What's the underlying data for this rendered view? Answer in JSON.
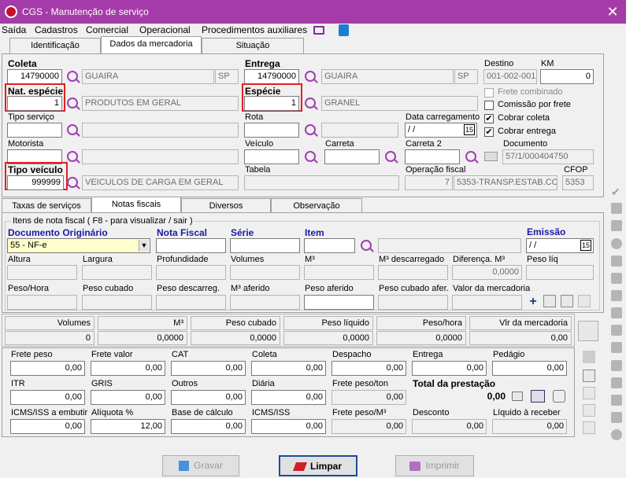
{
  "window": {
    "title": "CGS - Manutenção de serviço",
    "close": "✕"
  },
  "menu": [
    "Saída",
    "Cadastros",
    "Comercial",
    "Operacional",
    "Procedimentos auxiliares"
  ],
  "top_tabs": [
    "Identificação",
    "Dados da mercadoria",
    "Situação"
  ],
  "coleta": {
    "label": "Coleta",
    "cep": "14790000",
    "cidade": "GUAIRA",
    "uf": "SP"
  },
  "entrega": {
    "label": "Entrega",
    "cep": "14790000",
    "cidade": "GUAIRA",
    "uf": "SP"
  },
  "destino": {
    "label": "Destino",
    "value": "001-002-001"
  },
  "km": {
    "label": "KM",
    "value": "0"
  },
  "nat_especie": {
    "label": "Nat. espécie",
    "value": "1",
    "desc": "PRODUTOS EM GERAL"
  },
  "especie": {
    "label": "Espécie",
    "value": "1",
    "desc": "GRANEL"
  },
  "checks": {
    "frete_combinado": "Frete combinado",
    "comissao_frete": "Comissão por frete",
    "cobrar_coleta": "Cobrar coleta",
    "cobrar_entrega": "Cobrar entrega",
    "check_mark": "✔"
  },
  "tipo_servico": {
    "label": "Tipo serviço"
  },
  "rota": {
    "label": "Rota"
  },
  "data_carregamento": {
    "label": "Data carregamento",
    "value": " /  /",
    "cal": "15"
  },
  "motorista": {
    "label": "Motorista"
  },
  "veiculo": {
    "label": "Veículo"
  },
  "carreta": {
    "label": "Carreta"
  },
  "carreta2": {
    "label": "Carreta 2"
  },
  "documento": {
    "label": "Documento",
    "value": "57/1/000404750"
  },
  "tipo_veiculo": {
    "label": "Tipo veículo",
    "value": "999999",
    "desc": "VEICULOS DE CARGA EM GERAL"
  },
  "tabela": {
    "label": "Tabela"
  },
  "operacao_fiscal": {
    "label": "Operação fiscal",
    "code": "7",
    "desc": "5353-TRANSP.ESTAB.CO"
  },
  "cfop": {
    "label": "CFOP",
    "value": "5353"
  },
  "sub_tabs": [
    "Taxas de serviços",
    "Notas fiscais",
    "Diversos",
    "Observação"
  ],
  "itens": {
    "group_label": "Itens de nota fiscal ( F8 - para visualizar / sair )",
    "doc_originario_label": "Documento Originário",
    "doc_originario_value": "55 - NF-e",
    "nota_fiscal_label": "Nota Fiscal",
    "serie_label": "Série",
    "item_label": "Item",
    "emissao_label": "Emissão",
    "emissao_value": " /  /",
    "emissao_cal": "15",
    "row2_labels": [
      "Altura",
      "Largura",
      "Profundidade",
      "Volumes",
      "M³",
      "M³ descarregado",
      "Diferença. M³",
      "Peso líq"
    ],
    "diferenca_value": "0,0000",
    "row3_labels": [
      "Peso/Hora",
      "Peso cubado",
      "Peso descarreg.",
      "M³ aferido",
      "Peso aferido",
      "Peso cubado afer.",
      "Valor da mercadoria"
    ],
    "add_icon": "+"
  },
  "summary": {
    "headers": [
      "Volumes",
      "M³",
      "Peso cubado",
      "Peso líquido",
      "Peso/hora",
      "Vlr da mercadoria"
    ],
    "values": [
      "0",
      "0,0000",
      "0,0000",
      "0,0000",
      "0,0000",
      "0,00"
    ]
  },
  "prestacao": {
    "row1": [
      {
        "label": "Frete peso",
        "value": "0,00"
      },
      {
        "label": "Frete valor",
        "value": "0,00"
      },
      {
        "label": "CAT",
        "value": "0,00"
      },
      {
        "label": "Coleta",
        "value": "0,00"
      },
      {
        "label": "Despacho",
        "value": "0,00"
      },
      {
        "label": "Entrega",
        "value": "0,00"
      },
      {
        "label": "Pedágio",
        "value": "0,00"
      }
    ],
    "row2": [
      {
        "label": "ITR",
        "value": "0,00"
      },
      {
        "label": "GRIS",
        "value": "0,00"
      },
      {
        "label": "Outros",
        "value": "0,00"
      },
      {
        "label": "Diária",
        "value": "0,00"
      },
      {
        "label": "Frete peso/ton",
        "value": "0,00"
      }
    ],
    "total_label": "Total da prestação",
    "total_value": "0,00",
    "row3": [
      {
        "label": "ICMS/ISS a embutir",
        "value": "0,00"
      },
      {
        "label": "Alíquota %",
        "value": "12,00"
      },
      {
        "label": "Base de cálculo",
        "value": "0,00"
      },
      {
        "label": "ICMS/ISS",
        "value": "0,00"
      },
      {
        "label": "Frete peso/M³",
        "value": "0,00"
      },
      {
        "label": "Desconto",
        "value": "0,00"
      },
      {
        "label": "Líquido à receber",
        "value": "0,00"
      }
    ]
  },
  "buttons": {
    "gravar": "Gravar",
    "limpar": "Limpar",
    "imprimir": "Imprimir"
  },
  "colors": {
    "titlebar": "#a53ba8",
    "highlight": "#e0202a",
    "accent_purple": "#a040b0"
  }
}
